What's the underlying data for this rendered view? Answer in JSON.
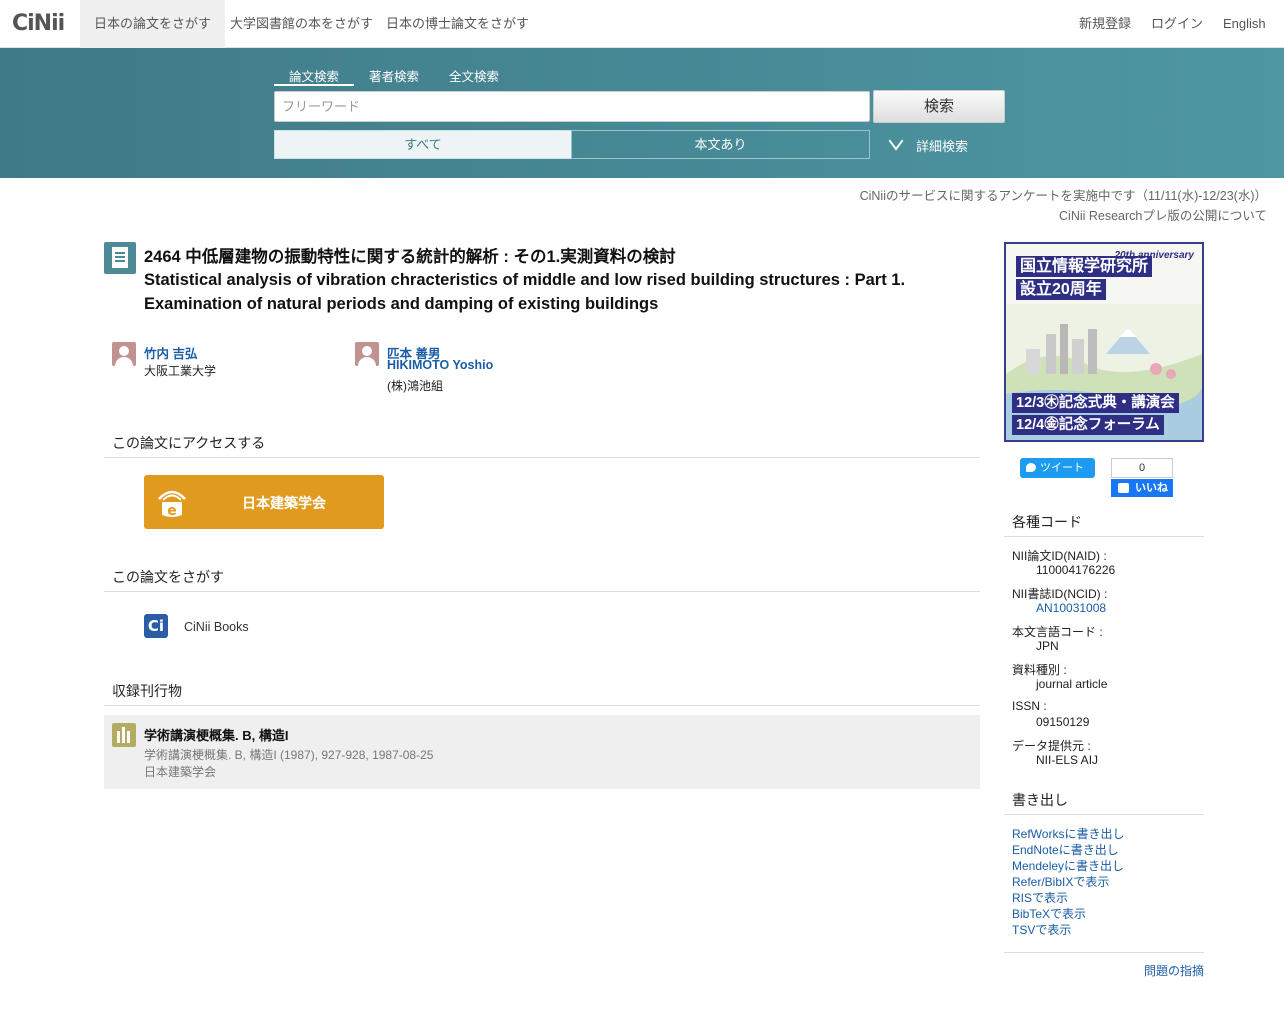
{
  "header": {
    "logo": "CiNii",
    "tabs": [
      {
        "label": "日本の論文をさがす",
        "active": true
      },
      {
        "label": "大学図書館の本をさがす",
        "active": false
      },
      {
        "label": "日本の博士論文をさがす",
        "active": false
      }
    ],
    "register": "新規登録",
    "login": "ログイン",
    "language": "English"
  },
  "search": {
    "tabs": [
      "論文検索",
      "著者検索",
      "全文検索"
    ],
    "placeholder": "フリーワード",
    "button": "検索",
    "filter_all": "すべて",
    "filter_fulltext": "本文あり",
    "advanced": "詳細検索"
  },
  "notices": [
    "CiNiiのサービスに関するアンケートを実施中です（11/11(水)-12/23(水)）",
    "CiNii Researchプレ版の公開について"
  ],
  "article": {
    "title_ja": "2464 中低層建物の振動特性に関する統計的解析 : その1.実測資料の検討",
    "title_en": "Statistical analysis of vibration chracteristics of middle and low rised building structures : Part 1. Examination of natural periods and damping of existing buildings",
    "authors": [
      {
        "name": "竹内 吉弘",
        "name_en": "",
        "affiliation": "大阪工業大学"
      },
      {
        "name": "匹本 善男",
        "name_en": "HIKIMOTO Yoshio",
        "affiliation": "(株)鴻池組"
      }
    ]
  },
  "access": {
    "heading": "この論文にアクセスする",
    "publisher_button": "日本建築学会"
  },
  "find": {
    "heading": "この論文をさがす",
    "cinii_books": "CiNii Books"
  },
  "journal": {
    "heading": "収録刊行物",
    "title": "学術講演梗概集. B, 構造I",
    "citation": "学術講演梗概集. B, 構造I (1987), 927-928, 1987-08-25",
    "publisher": "日本建築学会"
  },
  "banner": {
    "line1": "国立情報学研究所",
    "line2": "設立20周年",
    "badge": "20th anniversary",
    "line3": "12/3㊍記念式典・講演会",
    "line4": "12/4㊎記念フォーラム"
  },
  "social": {
    "tweet": "ツイート",
    "like_count": "0",
    "like": "いいね"
  },
  "codes": {
    "heading": "各種コード",
    "items": [
      {
        "label": "NII論文ID(NAID) :",
        "value": "110004176226",
        "link": false
      },
      {
        "label": "NII書誌ID(NCID) :",
        "value": "AN10031008",
        "link": true
      },
      {
        "label": "本文言語コード :",
        "value": "JPN",
        "link": false
      },
      {
        "label": "資料種別 :",
        "value": "journal article",
        "link": false
      },
      {
        "label": "ISSN :",
        "value": "09150129",
        "link": false
      },
      {
        "label": "データ提供元 :",
        "value": "NII-ELS  AIJ",
        "link": false
      }
    ]
  },
  "export": {
    "heading": "書き出し",
    "items": [
      "RefWorksに書き出し",
      "EndNoteに書き出し",
      "Mendeleyに書き出し",
      "Refer/BibIXで表示",
      "RISで表示",
      "BibTeXで表示",
      "TSVで表示"
    ]
  },
  "report": "問題の指摘"
}
